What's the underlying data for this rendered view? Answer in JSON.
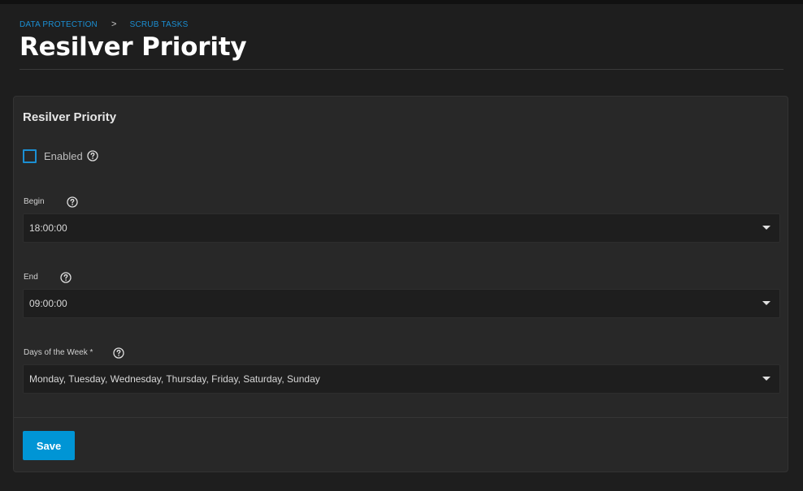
{
  "breadcrumb": {
    "items": [
      "DATA PROTECTION",
      "SCRUB TASKS"
    ],
    "separator": ">"
  },
  "page": {
    "title": "Resilver Priority"
  },
  "form": {
    "title": "Resilver Priority",
    "enabled": {
      "label": "Enabled",
      "checked": false
    },
    "begin": {
      "label": "Begin",
      "value": "18:00:00"
    },
    "end": {
      "label": "End",
      "value": "09:00:00"
    },
    "days": {
      "label": "Days of the Week *",
      "value": "Monday, Tuesday, Wednesday, Thursday, Friday, Saturday, Sunday"
    },
    "save_label": "Save"
  },
  "colors": {
    "accent": "#0095d5",
    "link": "#1b8fd3",
    "background": "#1e1e1e",
    "card": "#282828"
  },
  "icons": {
    "help": "help-circle-icon",
    "dropdown": "caret-down-icon"
  }
}
